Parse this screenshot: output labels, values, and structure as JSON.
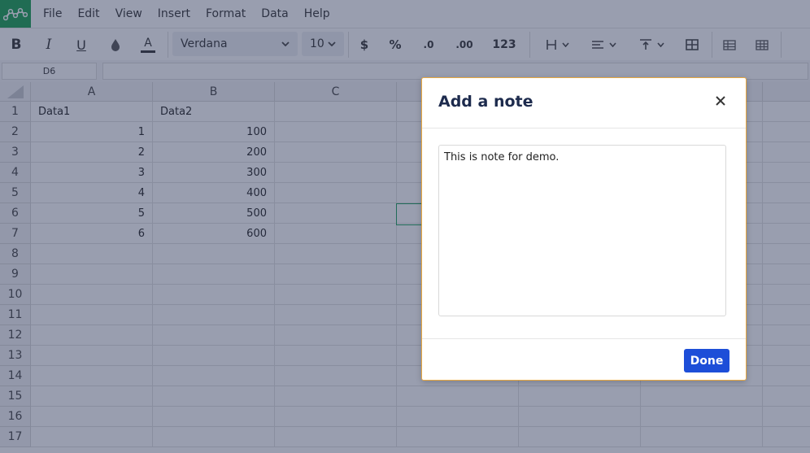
{
  "menu": {
    "items": [
      "File",
      "Edit",
      "View",
      "Insert",
      "Format",
      "Data",
      "Help"
    ]
  },
  "toolbar": {
    "bold": "B",
    "italic": "I",
    "underline": "U",
    "text_color": "A",
    "font": "Verdana",
    "font_size": "10",
    "currency": "$",
    "percent": "%",
    "decrease_decimals": ".0",
    "increase_decimals": ".00",
    "number_format": "123"
  },
  "formula_bar": {
    "cell_ref": "D6",
    "value": ""
  },
  "sheet": {
    "columns": [
      "A",
      "B",
      "C"
    ],
    "rows": [
      "1",
      "2",
      "3",
      "4",
      "5",
      "6",
      "7",
      "8",
      "9",
      "10",
      "11",
      "12",
      "13",
      "14",
      "15",
      "16",
      "17"
    ],
    "cells": [
      [
        "Data1",
        "Data2"
      ],
      [
        "1",
        "100"
      ],
      [
        "2",
        "200"
      ],
      [
        "3",
        "300"
      ],
      [
        "4",
        "400"
      ],
      [
        "5",
        "500"
      ],
      [
        "6",
        "600"
      ]
    ]
  },
  "dialog": {
    "title": "Add a note",
    "note_text": "This is note for demo.",
    "done_label": "Done"
  },
  "colors": {
    "brand": "#17a050",
    "primary_button": "#1d4ed8",
    "dialog_border": "#e9a840",
    "selection": "#19a05a"
  }
}
